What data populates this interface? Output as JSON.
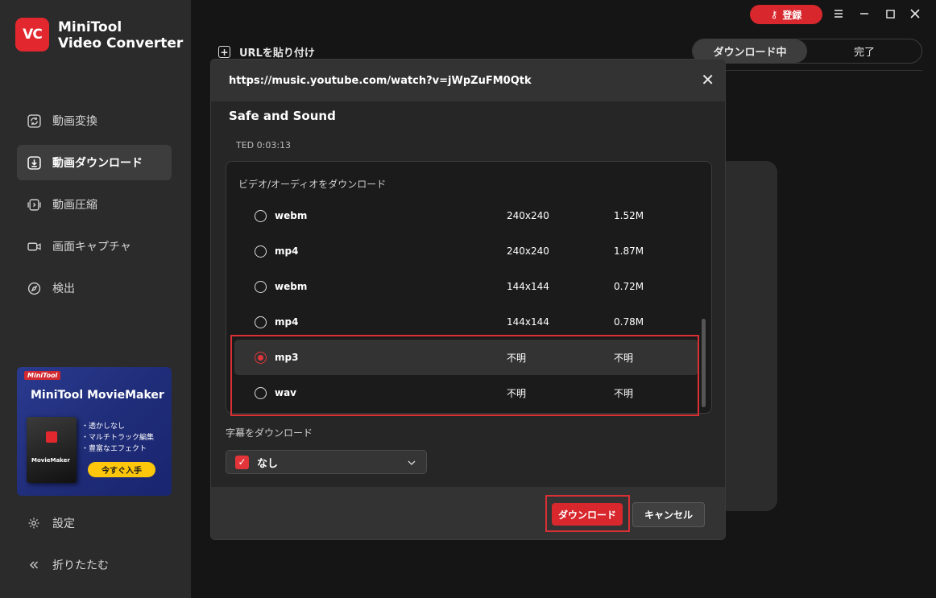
{
  "app": {
    "logo_text": "VC",
    "title_line1": "MiniTool",
    "title_line2": "Video Converter"
  },
  "sidebar": {
    "items": [
      {
        "label": "動画変換",
        "icon": "convert-icon"
      },
      {
        "label": "動画ダウンロード",
        "icon": "download-icon",
        "active": true
      },
      {
        "label": "動画圧縮",
        "icon": "compress-icon"
      },
      {
        "label": "画面キャプチャ",
        "icon": "camera-icon"
      },
      {
        "label": "検出",
        "icon": "compass-icon"
      }
    ],
    "settings_label": "設定",
    "collapse_label": "折りたたむ"
  },
  "promo": {
    "badge": "MiniTool",
    "title": "MiniTool MovieMaker",
    "box_name": "MovieMaker",
    "features": [
      "・透かしなし",
      "・マルチトラック編集",
      "・豊富なエフェクト"
    ],
    "cta": "今すぐ入手"
  },
  "header": {
    "register_label": "登録",
    "paste_url_label": "URLを貼り付け",
    "tabs": [
      "ダウンロード中",
      "完了"
    ]
  },
  "dialog": {
    "url": "https://music.youtube.com/watch?v=jWpZuFM0Qtk",
    "title": "Safe and Sound",
    "meta": "TED 0:03:13",
    "formats_label": "ビデオ/オーディオをダウンロード",
    "formats": [
      {
        "name": "webm",
        "resolution": "240x240",
        "size": "1.52M",
        "selected": false
      },
      {
        "name": "mp4",
        "resolution": "240x240",
        "size": "1.87M",
        "selected": false
      },
      {
        "name": "webm",
        "resolution": "144x144",
        "size": "0.72M",
        "selected": false
      },
      {
        "name": "mp4",
        "resolution": "144x144",
        "size": "0.78M",
        "selected": false
      },
      {
        "name": "mp3",
        "resolution": "不明",
        "size": "不明",
        "selected": true
      },
      {
        "name": "wav",
        "resolution": "不明",
        "size": "不明",
        "selected": false
      }
    ],
    "subtitle_label": "字幕をダウンロード",
    "subtitle_value": "なし",
    "download_label": "ダウンロード",
    "cancel_label": "キャンセル"
  },
  "colors": {
    "accent": "#d8272d",
    "sidebar_bg": "#2b2b2b",
    "app_bg": "#151515",
    "highlight": "#d93036"
  }
}
